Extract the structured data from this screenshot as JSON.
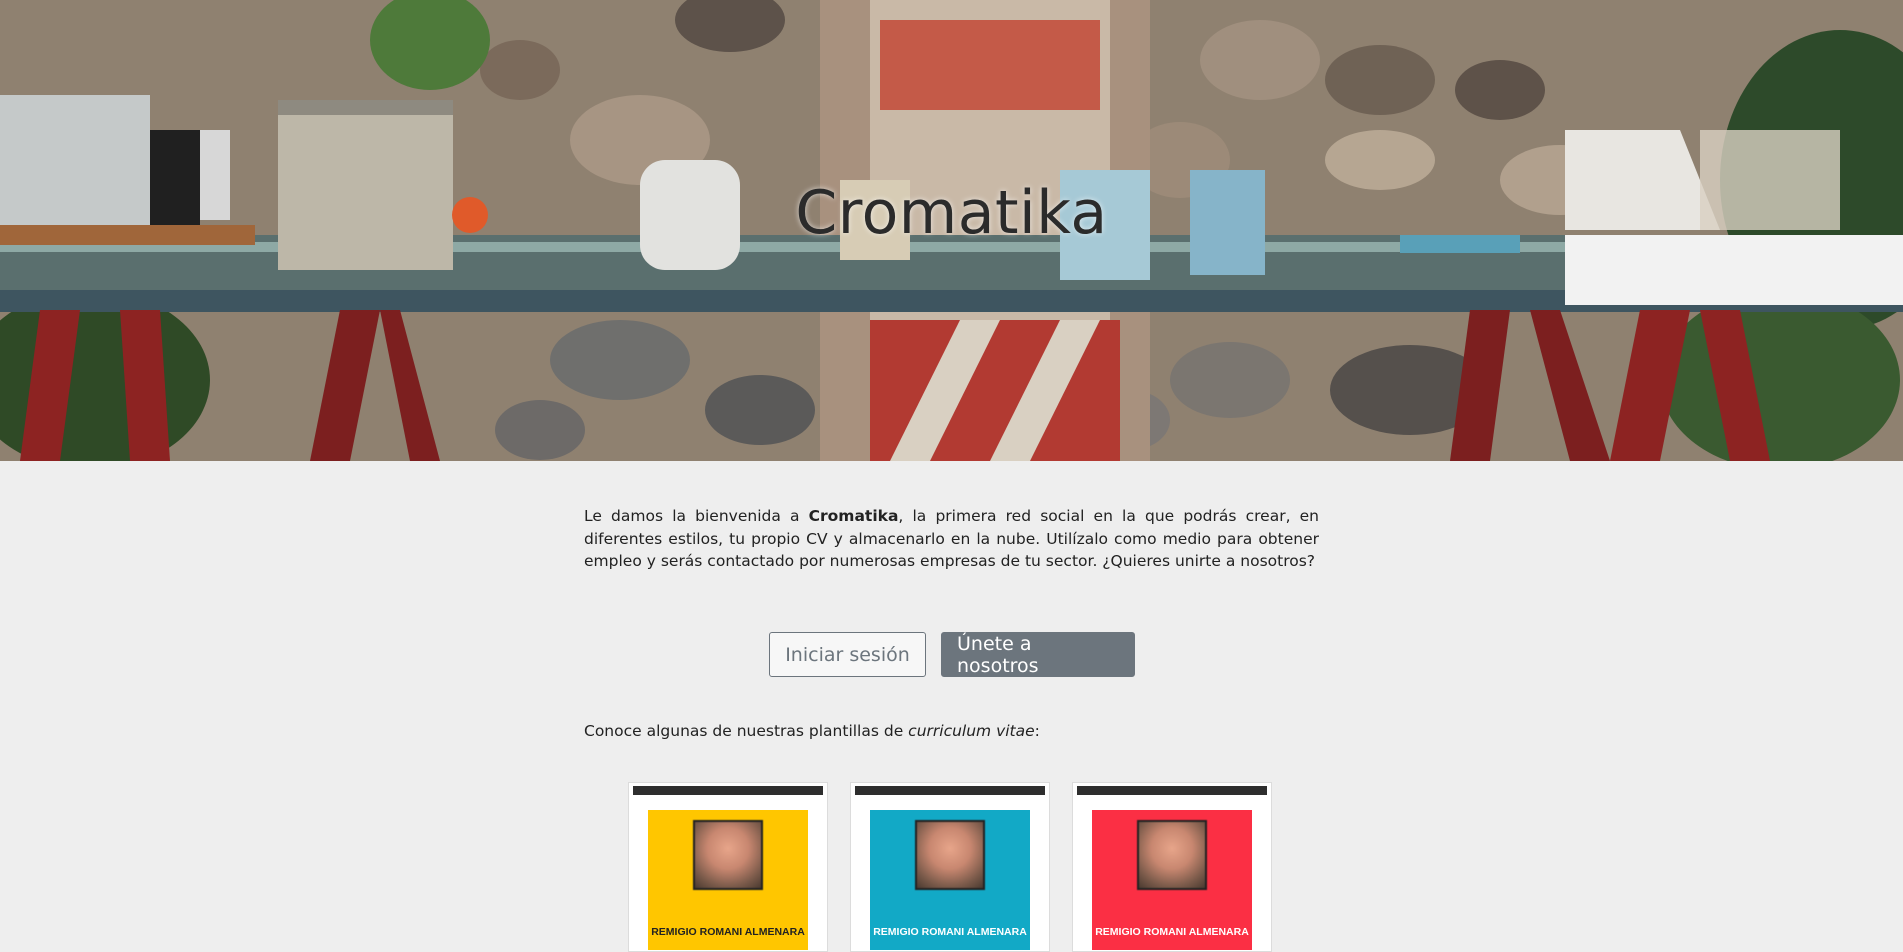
{
  "hero": {
    "title": "Cromatika"
  },
  "intro": {
    "prefix": "Le damos la bienvenida a ",
    "brand": "Cromatika",
    "suffix": ", la primera red social en la que podrás crear, en diferentes estilos, tu propio CV y almacenarlo en la nube. Utilízalo como medio para obtener empleo y serás contactado por numerosas empresas de tu sector. ¿Quieres unirte a nosotros?"
  },
  "actions": {
    "login_label": "Iniciar sesión",
    "join_label": "Únete a nosotros"
  },
  "templates": {
    "label_prefix": "Conoce algunas de nuestras plantillas de ",
    "label_emphasis": "curriculum vitae",
    "label_suffix": ":",
    "items": [
      {
        "name": "REMIGIO ROMANI ALMENARA",
        "color": "#ffc600"
      },
      {
        "name": "REMIGIO ROMANI ALMENARA",
        "color": "#12a9c6"
      },
      {
        "name": "REMIGIO ROMANI ALMENARA",
        "color": "#fb2f44"
      }
    ]
  }
}
